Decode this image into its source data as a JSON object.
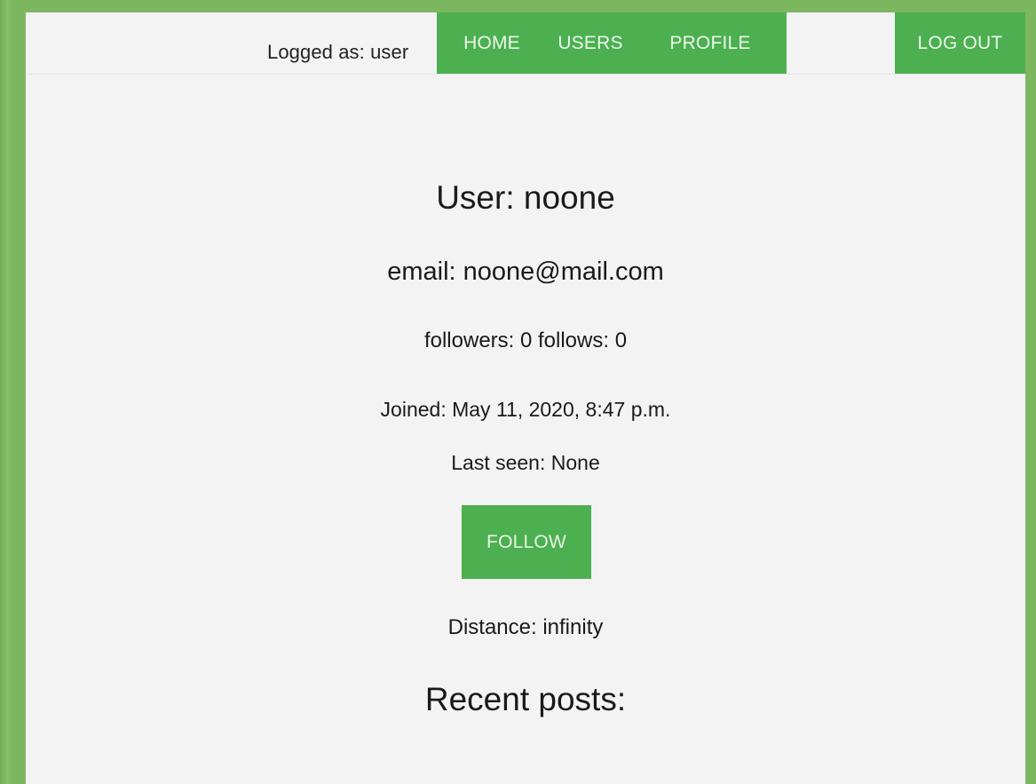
{
  "header": {
    "logged_as_text": "Logged as: user",
    "nav": {
      "home_label": "HOME",
      "users_label": "USERS",
      "profile_label": "PROFILE"
    },
    "logout_label": "LOG OUT"
  },
  "profile": {
    "title": "User: noone",
    "email": "email: noone@mail.com",
    "follow_stats": "followers: 0 follows: 0",
    "joined": "Joined: May 11, 2020, 8:47 p.m.",
    "last_seen": "Last seen: None",
    "follow_button_label": "FOLLOW",
    "distance": "Distance: infinity"
  },
  "recent_posts": {
    "title": "Recent posts:"
  },
  "colors": {
    "accent": "#4caf50",
    "page_background": "#f3f3f3",
    "frame_background": "#7cb760"
  }
}
